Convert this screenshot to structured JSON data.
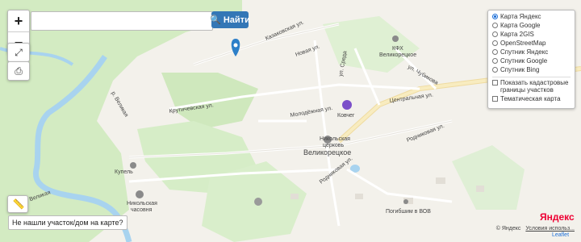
{
  "search": {
    "placeholder": "",
    "value": ""
  },
  "find_button": {
    "label": "Найти",
    "icon": "search-icon"
  },
  "zoom": {
    "in": "+",
    "out": "−"
  },
  "layers": {
    "options": [
      "Карта Яндекс",
      "Карта Google",
      "Карта 2GIS",
      "OpenStreetMap",
      "Спутник Яндекс",
      "Спутник Google",
      "Спутник Bing"
    ],
    "selected": "Карта Яндекс",
    "checkboxes": [
      "Показать кадастровые границы участков",
      "Тематическая карта"
    ]
  },
  "not_found_button": "Не нашли участок/дом на карте?",
  "map_labels": {
    "kazakov": "Казаковская ул.",
    "novaya": "Новая ул.",
    "kfh": "КФХ",
    "kfh_name": "Великорецкое",
    "chubikova": "ул. Чубикова",
    "sreda": "ул. Среда",
    "tsentralnaya": "Центральная ул.",
    "molodezhnaya": "Молодёжная ул.",
    "koshevoy": "Ковчег",
    "kruticheskaya": "Крутичевская ул.",
    "nikolskaya": "Никольская",
    "tserkov": "церковь",
    "village": "Великорецкое",
    "rodnikovaya1": "Родниковая ул.",
    "rodnikovaya2": "Родниковая ул.",
    "kupel": "Купель",
    "chasovnya1": "Никольская",
    "chasovnya2": "часовня",
    "velikaya": "р. Великая",
    "pogibshim": "Погибшим в ВОВ",
    "river2": "р. Великая"
  },
  "attribution": {
    "yandex": "© Яндекс",
    "terms": "Условия использ...",
    "logo": "Яндекс",
    "leaflet": "Leaflet"
  },
  "colors": {
    "accent": "#3477b6",
    "marker": "#2d7fc8",
    "river": "#9bc9e8",
    "forest": "#cce8b8",
    "road_main": "#f4e6a6"
  }
}
